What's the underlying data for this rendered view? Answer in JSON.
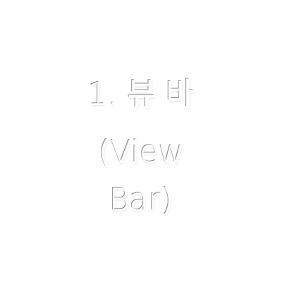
{
  "caption": {
    "lines": [
      "1. 뷰 바",
      "(View",
      "Bar)"
    ]
  },
  "colors": {
    "background": "#fefefe",
    "emboss_shadow": "#8d8d8d"
  }
}
